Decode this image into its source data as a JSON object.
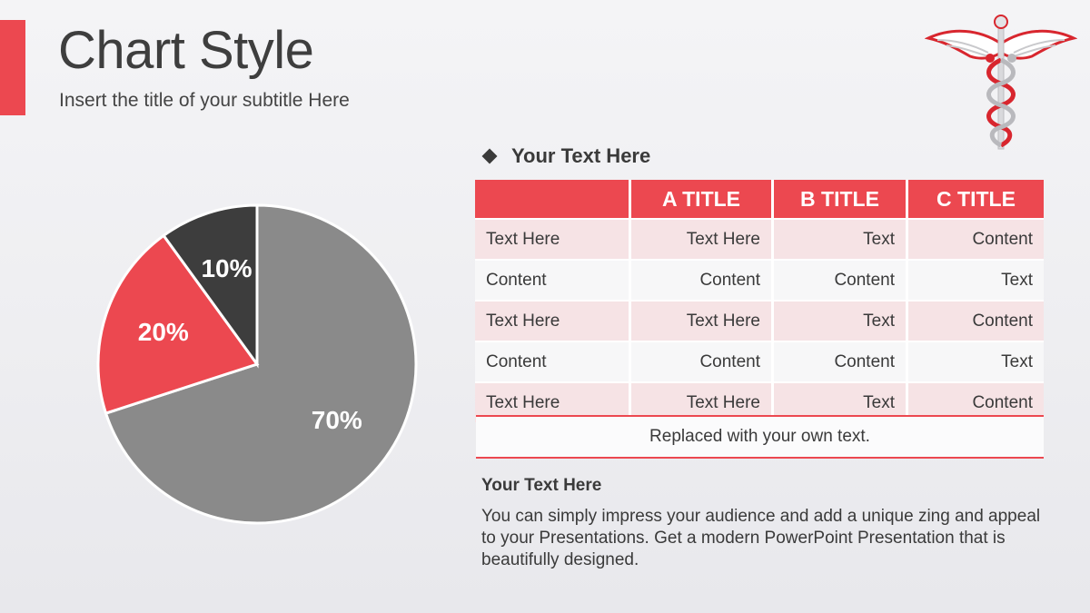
{
  "header": {
    "title": "Chart Style",
    "subtitle": "Insert the title  of your subtitle Here"
  },
  "logo": {
    "icon": "caduceus-icon"
  },
  "colors": {
    "accent": "#ec4850",
    "dark": "#3d3d3d",
    "gray": "#8a8a8a"
  },
  "chart_data": {
    "type": "pie",
    "slices": [
      {
        "value": 70,
        "label": "70%",
        "color": "#8a8a8a"
      },
      {
        "value": 20,
        "label": "20%",
        "color": "#ec4850"
      },
      {
        "value": 10,
        "label": "10%",
        "color": "#3d3d3d"
      }
    ]
  },
  "section": {
    "heading": "Your Text  Here"
  },
  "table": {
    "headers": [
      "",
      "A TITLE",
      "B TITLE",
      "C TITLE"
    ],
    "rows": [
      [
        "Text Here",
        "Text Here",
        "Text",
        "Content"
      ],
      [
        "Content",
        "Content",
        "Content",
        "Text"
      ],
      [
        "Text Here",
        "Text Here",
        "Text",
        "Content"
      ],
      [
        "Content",
        "Content",
        "Content",
        "Text"
      ],
      [
        "Text Here",
        "Text Here",
        "Text",
        "Content"
      ]
    ],
    "footer": "Replaced with your own text."
  },
  "description": {
    "heading": "Your Text  Here",
    "body": "You can simply impress your audience and add a unique zing and appeal to your Presentations. Get a modern PowerPoint  Presentation that is beautifully designed."
  }
}
